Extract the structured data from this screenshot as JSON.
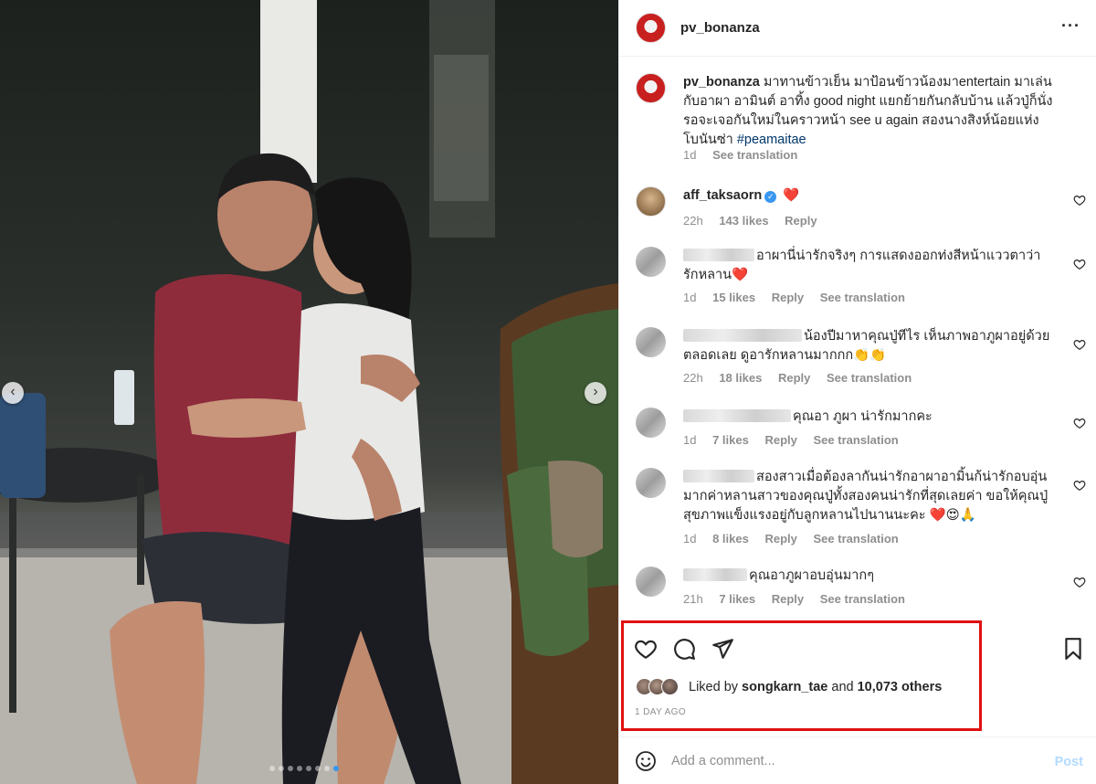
{
  "header": {
    "username": "pv_bonanza",
    "more_icon": "more-horizontal-icon"
  },
  "caption": {
    "username": "pv_bonanza",
    "text": "มาทานข้าวเย็น มาป้อนข้าวน้องมาentertain มาเล่นกับอาผา อามินต์ อาทิ้ง good night แยกย้ายกันกลับบ้าน แล้วปู่ก็นั่งรอจะเจอกันใหม่ในคราวหน้า see u again สองนางสิงห์น้อยแห่งโบนันซ่า",
    "hashtag": "#peamaitae",
    "time": "1d",
    "see_translation": "See translation"
  },
  "comments": [
    {
      "username": "aff_taksaorn",
      "text": "❤️",
      "time": "22h",
      "likes": "143 likes",
      "reply": "Reply",
      "verified": true
    },
    {
      "text": "อาผานี่น่ารักจริงๆ การแสดงออกท่งสีหน้าแววตาว่ารักหลาน❤️",
      "time": "1d",
      "likes": "15 likes",
      "reply": "Reply",
      "see_translation": "See translation"
    },
    {
      "text": "น้องปีมาหาคุณปู่ทีไร เห็นภาพอาภูผาอยู่ด้วยตลอดเลย ดูอารักหลานมากกก👏👏",
      "time": "22h",
      "likes": "18 likes",
      "reply": "Reply",
      "see_translation": "See translation"
    },
    {
      "text": "คุณอา ภูผา น่ารักมากคะ",
      "time": "1d",
      "likes": "7 likes",
      "reply": "Reply",
      "see_translation": "See translation"
    },
    {
      "text": "สองสาวเมื่อต้องลากันน่ารักอาผาอามิ้นก้น่ารักอบอุ่นมากค่าหลานสาวของคุณปู่ทั้งสองคนน่ารักที่สุดเลยค่า ขอให้คุณปู่สุขภาพแข็งแรงอยู่กับลูกหลานไปนานนะคะ ❤️😍🙏",
      "time": "1d",
      "likes": "8 likes",
      "reply": "Reply",
      "see_translation": "See translation"
    },
    {
      "text": "คุณอาภูผาอบอุ่นมากๆ",
      "time": "21h",
      "likes": "7 likes",
      "reply": "Reply",
      "see_translation": "See translation"
    }
  ],
  "likes": {
    "prefix": "Liked by",
    "user": "songkarn_tae",
    "middle": "and",
    "count": "10,073 others"
  },
  "time_ago": "1 DAY AGO",
  "add_comment": {
    "placeholder": "Add a comment...",
    "post_label": "Post"
  },
  "photo": {
    "carousel_pages": 8,
    "active_page": 7
  },
  "colors": {
    "link": "#00376b",
    "highlight_box": "#e01010",
    "post_disabled": "#b3dbff",
    "verified": "#3897f0"
  }
}
